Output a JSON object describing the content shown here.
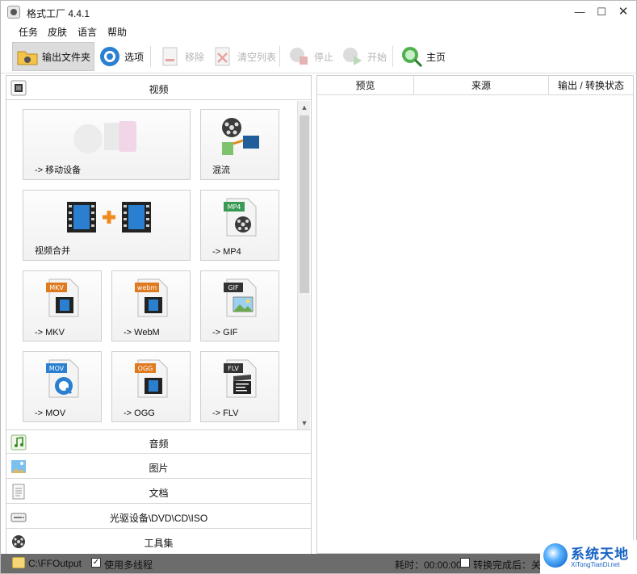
{
  "window": {
    "title": "格式工厂 4.4.1",
    "controls": {
      "minimize": "—",
      "maximize": "☐",
      "close": "✕"
    }
  },
  "menu": [
    "任务",
    "皮肤",
    "语言",
    "帮助"
  ],
  "toolbar": {
    "output_folder": "输出文件夹",
    "options": "选项",
    "remove": "移除",
    "clear_list": "清空列表",
    "stop": "停止",
    "start": "开始",
    "home": "主页"
  },
  "left_panel": {
    "video_header": "视频",
    "tiles": [
      {
        "label": "-> 移动设备",
        "icon": "mobile-device-icon"
      },
      {
        "label": "混流",
        "icon": "mux-icon"
      },
      {
        "label": "视频合并",
        "icon": "video-join-icon"
      },
      {
        "label": "-> MP4",
        "icon": "mp4-file-icon",
        "badge": "MP4",
        "badge_color": "#3a9a55"
      },
      {
        "label": "-> MKV",
        "icon": "mkv-file-icon",
        "badge": "MKV",
        "badge_color": "#e07a1f"
      },
      {
        "label": "-> WebM",
        "icon": "webm-file-icon",
        "badge": "webm",
        "badge_color": "#e07a1f"
      },
      {
        "label": "-> GIF",
        "icon": "gif-file-icon",
        "badge": "GIF",
        "badge_color": "#333333"
      },
      {
        "label": "-> MOV",
        "icon": "mov-file-icon",
        "badge": "MOV",
        "badge_color": "#2a7fd0"
      },
      {
        "label": "-> OGG",
        "icon": "ogg-file-icon",
        "badge": "OGG",
        "badge_color": "#e07a1f"
      },
      {
        "label": "-> FLV",
        "icon": "flv-file-icon",
        "badge": "FLV",
        "badge_color": "#333333"
      }
    ],
    "categories": [
      {
        "label": "音频",
        "icon": "music-note-icon"
      },
      {
        "label": "图片",
        "icon": "picture-icon"
      },
      {
        "label": "文档",
        "icon": "document-icon"
      },
      {
        "label": "光驱设备\\DVD\\CD\\ISO",
        "icon": "optical-drive-icon"
      },
      {
        "label": "工具集",
        "icon": "toolbox-icon"
      }
    ]
  },
  "right_panel": {
    "columns": [
      "预览",
      "来源",
      "输出 / 转换状态"
    ]
  },
  "statusbar": {
    "output_path": "C:\\FFOutput",
    "multithread_label": "使用多线程",
    "multithread_checked": true,
    "elapsed": "耗时：00:00:00",
    "after_convert": "转换完成后：关闭",
    "after_convert_checked": false
  },
  "watermark": {
    "title": "系统天地",
    "subtitle": "XiTongTianDi.net"
  },
  "colors": {
    "statusbar_bg": "#6c6c6c",
    "active_tool_bg": "#dcdcdc",
    "watermark_blue": "#1662c4"
  }
}
